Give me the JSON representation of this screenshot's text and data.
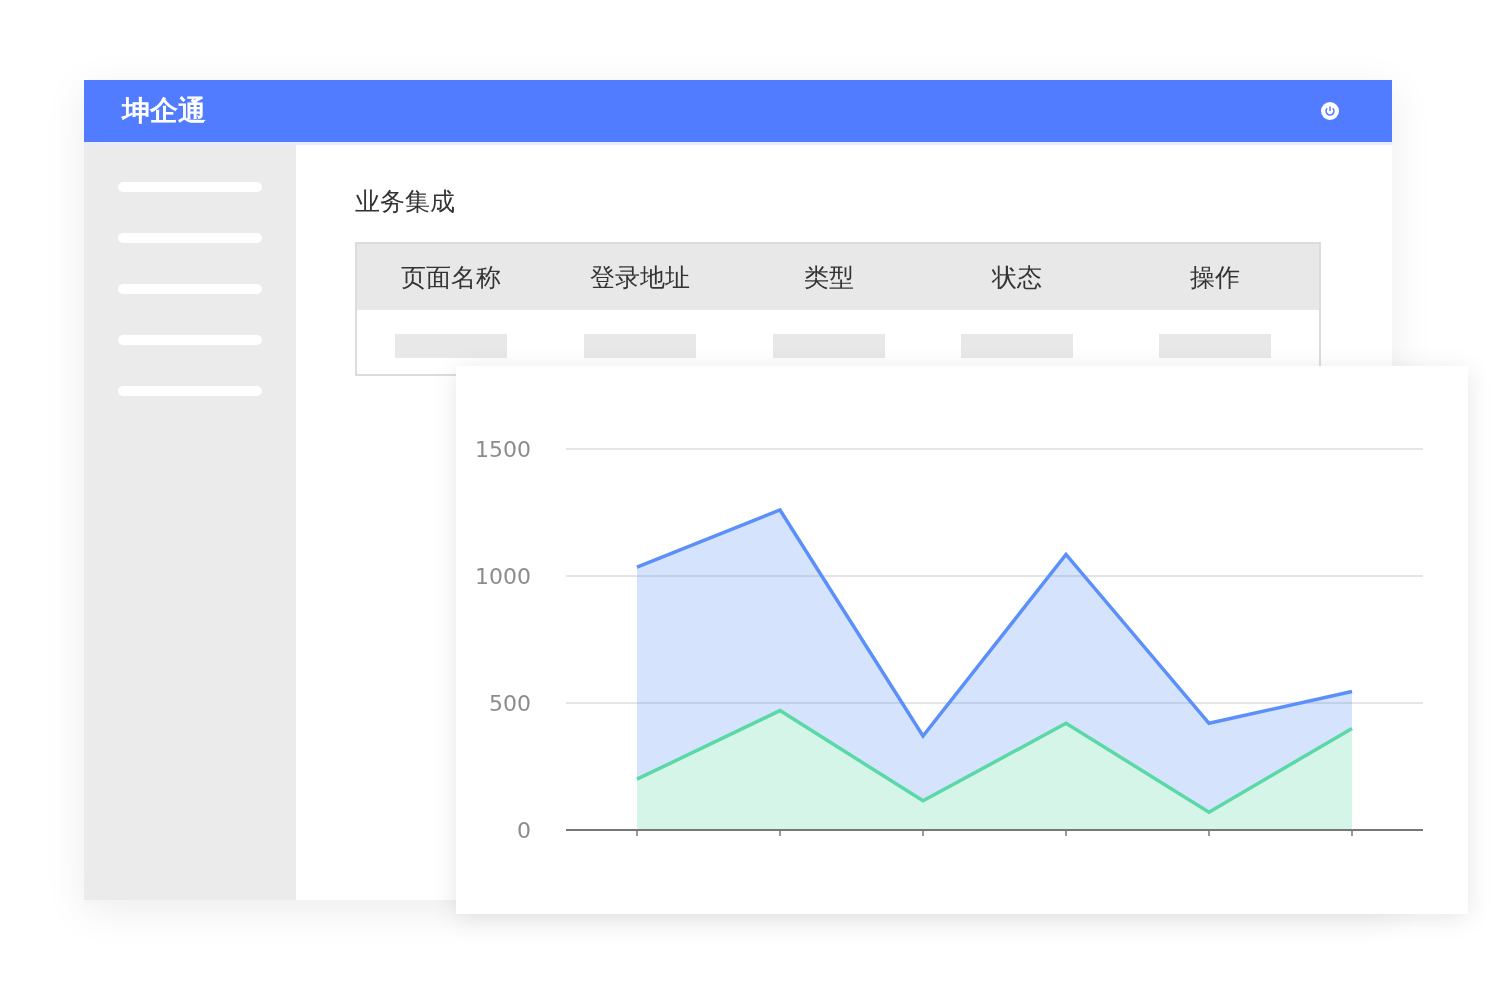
{
  "app": {
    "title": "坤企通"
  },
  "page": {
    "title": "业务集成"
  },
  "table": {
    "columns": [
      "页面名称",
      "登录地址",
      "类型",
      "状态",
      "操作"
    ]
  },
  "chart": {
    "chart_data": {
      "type": "area",
      "ylim": [
        0,
        1500
      ],
      "yticks": [
        0,
        500,
        1000,
        1500
      ],
      "stacked": false,
      "series": [
        {
          "color": "#5b8ff9",
          "values": [
            1035,
            1260,
            370,
            1085,
            420,
            545
          ]
        },
        {
          "color": "#5ad8a6",
          "values": [
            200,
            470,
            115,
            420,
            70,
            400
          ]
        }
      ]
    }
  }
}
